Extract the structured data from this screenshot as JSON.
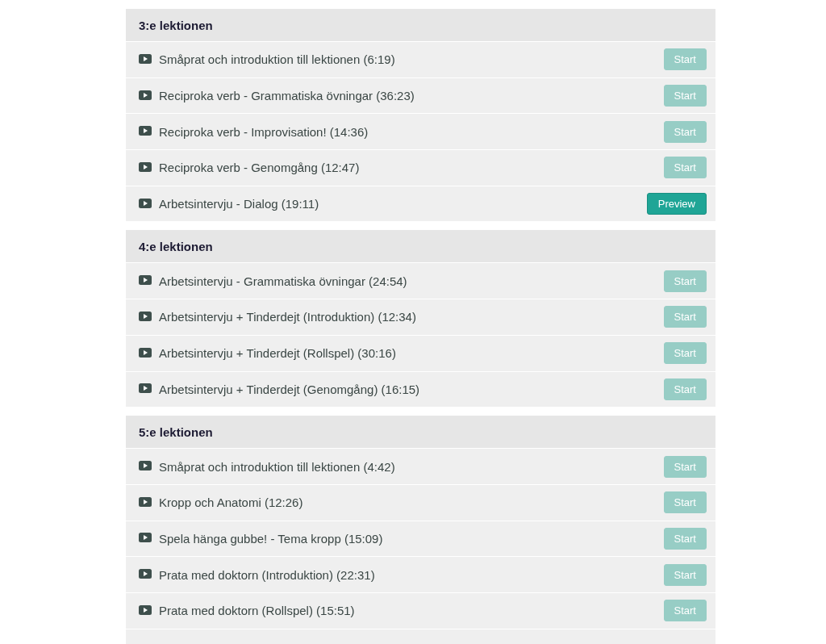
{
  "sections": [
    {
      "title": "3:e lektionen",
      "more_below": false,
      "lessons": [
        {
          "title": "Småprat och introduktion till lektionen (6:19)",
          "button": {
            "label": "Start",
            "disabled": true
          }
        },
        {
          "title": "Reciproka verb - Grammatiska övningar (36:23)",
          "button": {
            "label": "Start",
            "disabled": true
          }
        },
        {
          "title": "Reciproka verb - Improvisation! (14:36)",
          "button": {
            "label": "Start",
            "disabled": true
          }
        },
        {
          "title": "Reciproka verb - Genomgång (12:47)",
          "button": {
            "label": "Start",
            "disabled": true
          }
        },
        {
          "title": "Arbetsintervju - Dialog (19:11)",
          "button": {
            "label": "Preview",
            "disabled": false
          }
        }
      ]
    },
    {
      "title": "4:e lektionen",
      "more_below": false,
      "lessons": [
        {
          "title": "Arbetsintervju - Grammatiska övningar (24:54)",
          "button": {
            "label": "Start",
            "disabled": true
          }
        },
        {
          "title": "Arbetsintervju + Tinderdejt (Introduktion) (12:34)",
          "button": {
            "label": "Start",
            "disabled": true
          }
        },
        {
          "title": "Arbetsintervju + Tinderdejt (Rollspel) (30:16)",
          "button": {
            "label": "Start",
            "disabled": true
          }
        },
        {
          "title": "Arbetsintervju + Tinderdejt (Genomgång) (16:15)",
          "button": {
            "label": "Start",
            "disabled": true
          }
        }
      ]
    },
    {
      "title": "5:e lektionen",
      "more_below": true,
      "lessons": [
        {
          "title": "Småprat och introduktion till lektionen (4:42)",
          "button": {
            "label": "Start",
            "disabled": true
          }
        },
        {
          "title": "Kropp och Anatomi (12:26)",
          "button": {
            "label": "Start",
            "disabled": true
          }
        },
        {
          "title": "Spela hänga gubbe! - Tema kropp (15:09)",
          "button": {
            "label": "Start",
            "disabled": true
          }
        },
        {
          "title": "Prata med doktorn (Introduktion) (22:31)",
          "button": {
            "label": "Start",
            "disabled": true
          }
        },
        {
          "title": "Prata med doktorn (Rollspel) (15:51)",
          "button": {
            "label": "Start",
            "disabled": true
          }
        }
      ]
    }
  ]
}
